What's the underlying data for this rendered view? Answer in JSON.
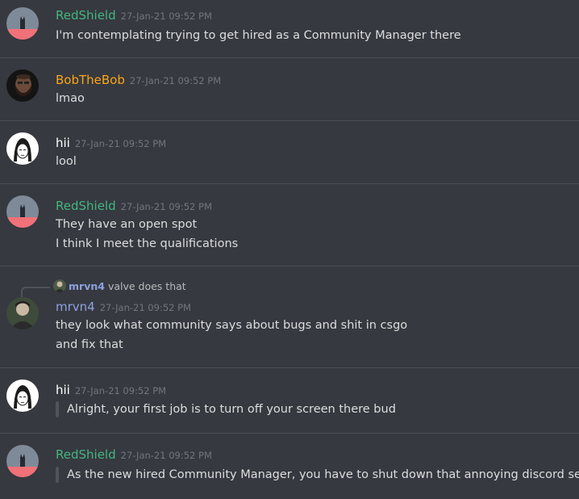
{
  "colors": {
    "background": "#36393f",
    "divider": "#4a4d53",
    "text": "#dcddde",
    "timestamp": "#72767d",
    "redshield": "#43b581",
    "bobthebob": "#faa61a",
    "hii": "#ffffff",
    "mrvn4": "#8ea1e1"
  },
  "messages": [
    {
      "author": "RedShield",
      "timestamp": "27-Jan-21 09:52 PM",
      "lines": [
        "I'm contemplating trying to get hired as a Community Manager there"
      ],
      "avatar_icon": "redshield-avatar-icon"
    },
    {
      "author": "BobTheBob",
      "timestamp": "27-Jan-21 09:52 PM",
      "lines": [
        "lmao"
      ],
      "avatar_icon": "bobthebob-avatar-icon"
    },
    {
      "author": "hii",
      "timestamp": "27-Jan-21 09:52 PM",
      "lines": [
        "lool"
      ],
      "avatar_icon": "hii-avatar-icon"
    },
    {
      "author": "RedShield",
      "timestamp": "27-Jan-21 09:52 PM",
      "lines": [
        "They have an open spot",
        "I think I meet the qualifications"
      ],
      "avatar_icon": "redshield-avatar-icon"
    },
    {
      "author": "mrvn4",
      "timestamp": "27-Jan-21 09:52 PM",
      "reply": {
        "author": "mrvn4",
        "text": "valve does that"
      },
      "lines": [
        "they look what community says about bugs and shit in csgo",
        "and fix that"
      ],
      "avatar_icon": "mrvn4-avatar-icon"
    },
    {
      "author": "hii",
      "timestamp": "27-Jan-21 09:52 PM",
      "quote": "Alright, your first job is to turn off your screen there bud",
      "avatar_icon": "hii-avatar-icon"
    },
    {
      "author": "RedShield",
      "timestamp": "27-Jan-21 09:52 PM",
      "quote": "As the new hired Community Manager, you have to shut down that annoying discord server",
      "avatar_icon": "redshield-avatar-icon"
    }
  ]
}
